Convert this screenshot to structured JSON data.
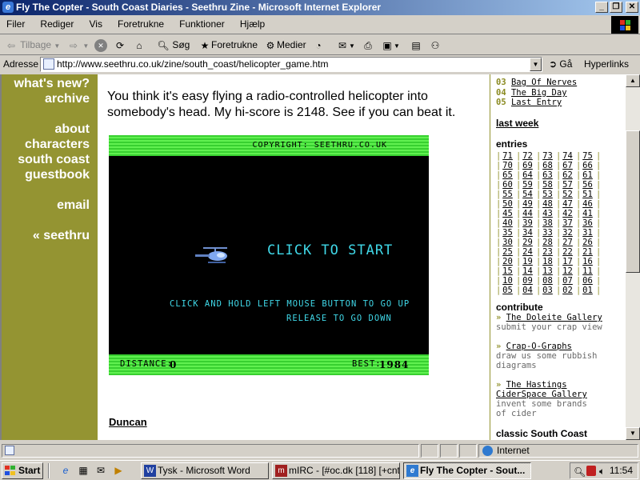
{
  "window": {
    "title": "Fly The Copter - South Coast Diaries - Seethru Zine - Microsoft Internet Explorer",
    "buttons": [
      "_",
      "❐",
      "✕"
    ]
  },
  "menu": [
    "Filer",
    "Rediger",
    "Vis",
    "Foretrukne",
    "Funktioner",
    "Hjælp"
  ],
  "toolbar": {
    "back": "Tilbage",
    "search": "Søg",
    "favorites": "Foretrukne",
    "media": "Medier"
  },
  "address": {
    "label": "Adresse",
    "url": "http://www.seethru.co.uk/zine/south_coast/helicopter_game.htm",
    "go": "Gå",
    "links": "Hyperlinks"
  },
  "nav": {
    "whats_new": "what's new?",
    "archive": "archive",
    "about": "about",
    "characters": "characters",
    "south_coast": "south coast",
    "guestbook": "guestbook",
    "email": "email",
    "seethru": "« seethru"
  },
  "main": {
    "intro": "You think it's easy flying a radio-controlled helicopter into somebody's head. My hi-score is 2148. See if you can beat it.",
    "author": "Duncan"
  },
  "game": {
    "copyright": "COPYRIGHT: SEETHRU.CO.UK",
    "start": "CLICK TO START",
    "instr1": "CLICK AND HOLD LEFT MOUSE BUTTON TO GO UP",
    "instr2": "RELEASE TO GO DOWN",
    "distance_label": "DISTANCE:",
    "distance_value": "0",
    "best_label": "BEST:",
    "best_value": "1984"
  },
  "sidebar": {
    "recent": [
      {
        "num": "03",
        "title": "Bag Of Nerves"
      },
      {
        "num": "04",
        "title": "The Big Day"
      },
      {
        "num": "05",
        "title": "Last Entry"
      }
    ],
    "last_week": "last week",
    "entries_heading": "entries",
    "entries": [
      [
        "71",
        "72",
        "73",
        "74",
        "75"
      ],
      [
        "70",
        "69",
        "68",
        "67",
        "66"
      ],
      [
        "65",
        "64",
        "63",
        "62",
        "61"
      ],
      [
        "60",
        "59",
        "58",
        "57",
        "56"
      ],
      [
        "55",
        "54",
        "53",
        "52",
        "51"
      ],
      [
        "50",
        "49",
        "48",
        "47",
        "46"
      ],
      [
        "45",
        "44",
        "43",
        "42",
        "41"
      ],
      [
        "40",
        "39",
        "38",
        "37",
        "36"
      ],
      [
        "35",
        "34",
        "33",
        "32",
        "31"
      ],
      [
        "30",
        "29",
        "28",
        "27",
        "26"
      ],
      [
        "25",
        "24",
        "23",
        "22",
        "21"
      ],
      [
        "20",
        "19",
        "18",
        "17",
        "16"
      ],
      [
        "15",
        "14",
        "13",
        "12",
        "11"
      ],
      [
        "10",
        "09",
        "08",
        "07",
        "06"
      ],
      [
        "05",
        "04",
        "03",
        "02",
        "01"
      ]
    ],
    "contribute_heading": "contribute",
    "contribute": [
      {
        "title": "The Doleite Gallery",
        "desc": "submit your crap view"
      },
      {
        "title": "Crap-O-Graphs",
        "desc": "draw us some rubbish diagrams"
      },
      {
        "title": "The Hastings CiderSpace Gallery",
        "desc": "invent some brands of cider"
      }
    ],
    "classic": "classic South Coast"
  },
  "status": {
    "zone": "Internet"
  },
  "taskbar": {
    "start": "Start",
    "tasks": [
      "Tysk - Microsoft Word",
      "mIRC - [#oc.dk [118] [+cnt...",
      "Fly The Copter - Sout..."
    ],
    "clock": "11:54"
  },
  "colors": {
    "olive": "#949432",
    "game_green": "#38d030",
    "game_cyan": "#40d8e8"
  }
}
